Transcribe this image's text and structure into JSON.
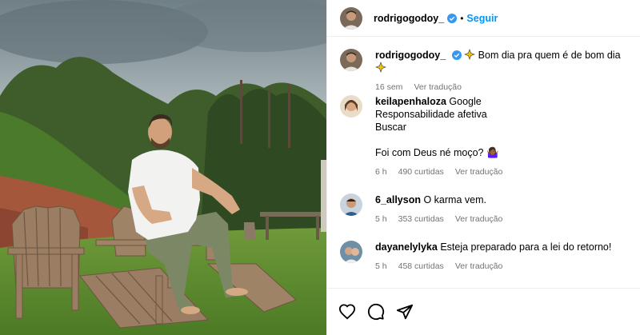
{
  "post": {
    "username": "rodrigogodoy_",
    "follow_label": "Seguir",
    "separator": "•",
    "caption": "Bom dia pra quem é de bom dia",
    "caption_time": "16 sem",
    "caption_translate": "Ver tradução"
  },
  "comments": [
    {
      "username": "keilapenhaloza",
      "lines": [
        "Google",
        "Responsabilidade afetiva",
        "Buscar",
        "",
        "Foi com Deus né moço? 🤷🏾‍♀️"
      ],
      "time": "6 h",
      "likes": "490 curtidas",
      "translate": "Ver tradução"
    },
    {
      "username": "6_allyson",
      "text": "O karma vem.",
      "time": "5 h",
      "likes": "353 curtidas",
      "translate": "Ver tradução"
    },
    {
      "username": "dayanelylyka",
      "text": "Esteja preparado para a lei do retorno!",
      "time": "5 h",
      "likes": "458 curtidas",
      "translate": "Ver tradução"
    }
  ],
  "icons": {
    "like": "heart-icon",
    "comment": "comment-icon",
    "share": "share-icon",
    "verified": "verified-badge-icon",
    "sparkle": "sparkle-star-icon"
  },
  "colors": {
    "link": "#0095f6",
    "muted": "#737373",
    "verified": "#3897f0",
    "border": "#efefef"
  }
}
